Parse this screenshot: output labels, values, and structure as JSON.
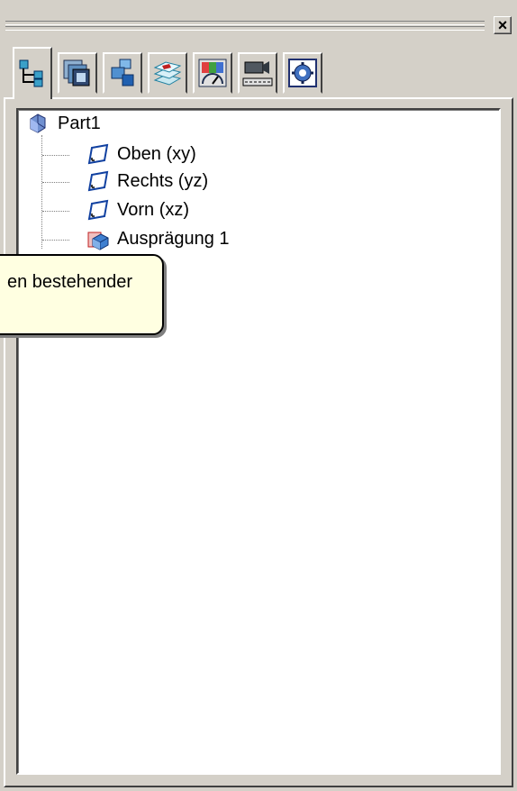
{
  "window": {
    "close_glyph": "×"
  },
  "tabs": [
    {
      "id": "feature-tree",
      "icon": "feature-tree-icon",
      "active": true
    },
    {
      "id": "layers",
      "icon": "stacked-pages-icon"
    },
    {
      "id": "config",
      "icon": "configuration-icon"
    },
    {
      "id": "sketches",
      "icon": "sketch-layers-icon"
    },
    {
      "id": "display",
      "icon": "display-manager-icon"
    },
    {
      "id": "camera",
      "icon": "camera-icon"
    },
    {
      "id": "settings",
      "icon": "settings-icon"
    }
  ],
  "tree": {
    "root": {
      "label": "Part1",
      "icon": "part-icon"
    },
    "children": [
      {
        "label": "Oben (xy)",
        "icon": "plane-icon"
      },
      {
        "label": "Rechts (yz)",
        "icon": "plane-icon"
      },
      {
        "label": "Vorn (xz)",
        "icon": "plane-icon"
      },
      {
        "label": "Ausprägung 1",
        "icon": "extrude-icon"
      }
    ]
  },
  "tooltip": {
    "text": "en bestehender"
  }
}
